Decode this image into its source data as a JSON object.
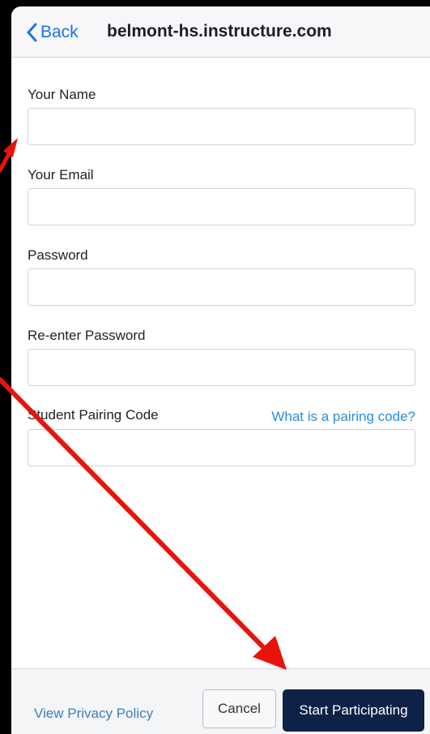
{
  "header": {
    "back_label": "Back",
    "title": "belmont-hs.instructure.com"
  },
  "form": {
    "fields": [
      {
        "label": "Your Name",
        "value": "",
        "placeholder": ""
      },
      {
        "label": "Your Email",
        "value": "",
        "placeholder": ""
      },
      {
        "label": "Password",
        "value": "",
        "placeholder": ""
      },
      {
        "label": "Re-enter Password",
        "value": "",
        "placeholder": ""
      },
      {
        "label": "Student Pairing Code",
        "value": "",
        "placeholder": ""
      }
    ],
    "pairing_help_link": "What is a pairing code?"
  },
  "footer": {
    "privacy_label": "View Privacy Policy",
    "cancel_label": "Cancel",
    "start_label": "Start Participating"
  },
  "colors": {
    "accent": "#1a73e8",
    "primary_button": "#0e2146",
    "annotation_arrow": "#e8140c"
  },
  "icons": {
    "back": "chevron-left-icon"
  }
}
